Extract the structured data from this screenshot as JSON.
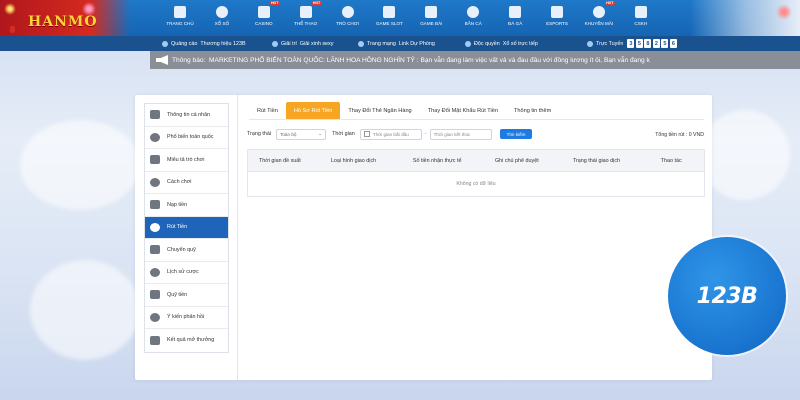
{
  "brand": {
    "logo_text": "123B",
    "logo_header_text": "HANMO",
    "colors": {
      "primary": "#1e64b8",
      "accent": "#f6a623",
      "header": "#1565b4",
      "subbar": "#19528f"
    }
  },
  "nav": {
    "items": [
      {
        "label": "TRANG CHỦ",
        "icon": "home-icon",
        "hot": ""
      },
      {
        "label": "XỔ SỐ",
        "icon": "lottery-icon",
        "hot": ""
      },
      {
        "label": "CASINO",
        "icon": "casino-icon",
        "hot": "HOT"
      },
      {
        "label": "THỂ THAO",
        "icon": "soccer-icon",
        "hot": "HOT"
      },
      {
        "label": "TRÒ CHƠI",
        "icon": "gamepad-icon",
        "hot": ""
      },
      {
        "label": "GAME SLOT",
        "icon": "slot-icon",
        "hot": ""
      },
      {
        "label": "GAME BÀI",
        "icon": "cards-icon",
        "hot": ""
      },
      {
        "label": "BẮN CÁ",
        "icon": "fish-icon",
        "hot": ""
      },
      {
        "label": "ĐÁ GÀ",
        "icon": "rooster-icon",
        "hot": ""
      },
      {
        "label": "ESPORTS",
        "icon": "esports-icon",
        "hot": ""
      },
      {
        "label": "KHUYẾN MÃI",
        "icon": "gift-icon",
        "hot": "HOT"
      },
      {
        "label": "CSKH",
        "icon": "support-icon",
        "hot": ""
      }
    ]
  },
  "subbar": {
    "ads_label": "Quảng cáo",
    "ads_value": "Thương hiệu 123B",
    "award_label": "Giải trí",
    "award_value": "Giải xinh sexy",
    "backup_label": "Trang mạng",
    "backup_value": "Link Dự Phòng",
    "rights_label": "Độc quyền",
    "rights_value": "Xổ số trực tiếp",
    "online_label": "Trực Tuyến",
    "online_digits": [
      "3",
      "5",
      "8",
      "2",
      "5",
      "6"
    ]
  },
  "marquee": {
    "label": "Thông báo:",
    "text": "MARKETING PHỔ BIẾN TOÀN QUỐC:   LÃNH HOA HỒNG NGHÌN TỶ : Bạn vẫn đang làm việc vất vả và đau đầu với đồng lương ít ỏi, Bạn vẫn đang k"
  },
  "sidebar": {
    "items": [
      {
        "label": "Thông tin cá nhân",
        "icon": "user-card-icon"
      },
      {
        "label": "Phổ biến toàn quốc",
        "icon": "diamond-icon"
      },
      {
        "label": "Miêu tả trò chơi",
        "icon": "gamepad-icon"
      },
      {
        "label": "Cách chơi",
        "icon": "dice-icon"
      },
      {
        "label": "Nạp tiền",
        "icon": "deposit-icon"
      },
      {
        "label": "Rút Tiền",
        "icon": "withdraw-icon"
      },
      {
        "label": "Chuyển quỹ",
        "icon": "transfer-icon"
      },
      {
        "label": "Lịch sử cược",
        "icon": "history-icon"
      },
      {
        "label": "Quỹ tiền",
        "icon": "wallet-icon"
      },
      {
        "label": "Ý kiến phản hồi",
        "icon": "chat-icon"
      },
      {
        "label": "Kết quả mở thưởng",
        "icon": "clock-icon"
      }
    ],
    "active_index": 5
  },
  "tabs": {
    "items": [
      "Rút Tiền",
      "Hồ Sơ Rút Tiền",
      "Thay Đổi Thẻ Ngân Hàng",
      "Thay Đổi Mật Khẩu Rút Tiền",
      "Thông tin thêm"
    ],
    "active_index": 1
  },
  "filters": {
    "status_label": "Trạng thái",
    "status_value": "Toàn bộ",
    "time_label": "Thời gian",
    "start_placeholder": "Thời gian bắt đầu",
    "separator": "-",
    "end_placeholder": "Thời gian kết thúc",
    "search_label": "Tìm kiếm",
    "total_text": "Tổng tiền rút : 0 VND"
  },
  "table": {
    "columns": [
      "Thời gian đề xuất",
      "Loại hình giao dịch",
      "Số tiền nhận thực tế",
      "Ghi chú phê duyệt",
      "Trạng thái giao dịch",
      "Thao tác"
    ],
    "empty_text": "Không có dữ liệu"
  }
}
